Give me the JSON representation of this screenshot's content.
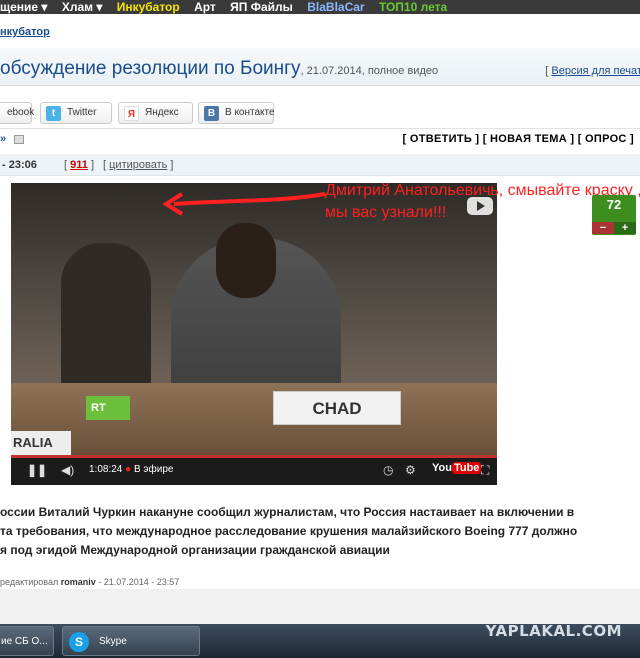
{
  "topnav": [
    "щение ▾",
    "Хлам ▾",
    "Инкубатор",
    "Арт",
    "ЯП Файлы",
    "BlaBlaCar",
    "ТОП10 лета"
  ],
  "topnav_colors": [
    "#ffffff",
    "#ffffff",
    "#f3e600",
    "#ffffff",
    "#ffffff",
    "#8ab7ff",
    "#69c832"
  ],
  "breadcrumb": "нкубатор",
  "post": {
    "title": "обсуждение резолюции по Боингу",
    "subtitle": ", 21.07.2014, полное видео",
    "print_prefix": "[ ",
    "print_label": "Версия для печати",
    "time": "- 23:06",
    "count": "911",
    "quote_label": "цитировать",
    "open_br": "[",
    "close_br": "]"
  },
  "share": {
    "facebook": "ebook",
    "twitter": "Twitter",
    "yandex": "Яндекс",
    "vk": "В контакте"
  },
  "actions": {
    "left": "»",
    "text": "[ ОТВЕТИТЬ ] [ НОВАЯ ТЕМА ] [ ОПРОС ]"
  },
  "video": {
    "nameplate": "CHAD",
    "rt_label": "RT",
    "left_plate": "RALIA",
    "time": "1:08:24",
    "live": "В эфире",
    "yt_you": "You",
    "yt_tube": "Tube"
  },
  "annotation": "Дмитрий Анатольевичь, смывайте краску , мы вас узнали!!!",
  "rating": {
    "value": "72",
    "minus": "−",
    "plus": "+"
  },
  "body_text": [
    "оссии Виталий Чуркин накануне сообщил журналистам, что Россия настаивает на включении в",
    "та требования, что международное расследование крушения малайзийского Boeing 777 должно",
    "я под эгидой Международной организации гражданской авиации"
  ],
  "edit_note": {
    "prefix": "редактировал ",
    "user": "romaniv",
    "suffix": " - 21.07.2014 - 23:57"
  },
  "taskbar": {
    "task1": "ие СБ О...",
    "task2": "Skype"
  },
  "watermark": "YAPLAKAL.COM"
}
